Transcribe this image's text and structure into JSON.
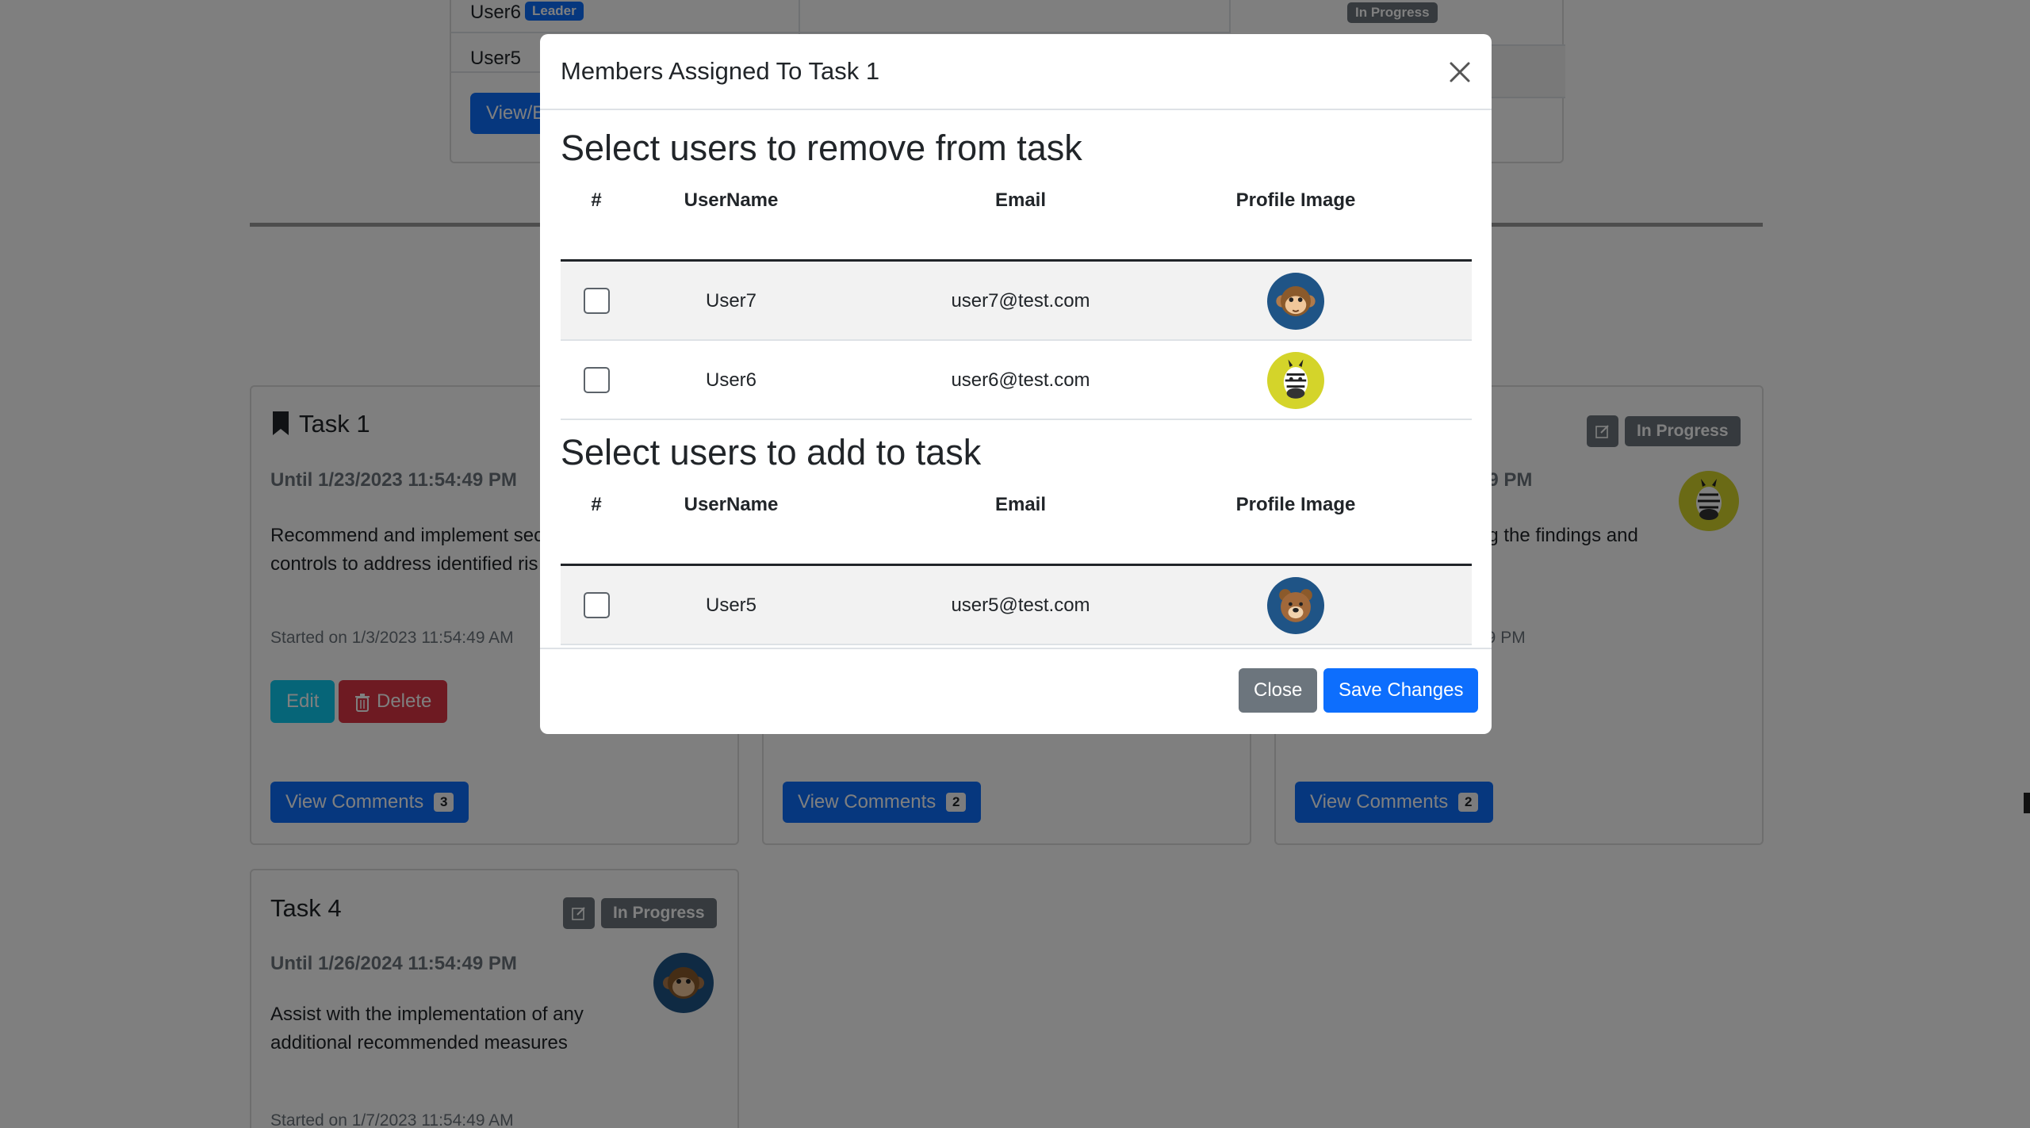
{
  "background": {
    "members": [
      {
        "name": "User6",
        "badge": "Leader"
      },
      {
        "name": "User5",
        "badge": ""
      }
    ],
    "members_button": "View/E",
    "top_status": "In Progress",
    "cards": [
      {
        "title": "Task 1",
        "until": "Until 1/23/2023 11:54:49 PM",
        "desc": "Recommend and implement sec controls to address identified ris",
        "started": "Started on 1/3/2023 11:54:49 AM",
        "edit": "Edit",
        "delete": "Delete",
        "comments": "View Comments",
        "comments_count": "3"
      },
      {
        "comments": "View Comments",
        "comments_count": "2"
      },
      {
        "until": "49 PM",
        "desc": "ng the findings and",
        "started": "49 PM",
        "status": "In Progress",
        "comments": "View Comments",
        "comments_count": "2"
      },
      {
        "title": "Task 4",
        "until": "Until 1/26/2024 11:54:49 PM",
        "desc": "Assist with the implementation of any additional recommended measures",
        "started": "Started on 1/7/2023 11:54:49 AM",
        "status": "In Progress"
      }
    ]
  },
  "modal": {
    "title": "Members Assigned To Task 1",
    "remove_section": {
      "heading": "Select users to remove from task",
      "columns": [
        "#",
        "UserName",
        "Email",
        "Profile Image"
      ],
      "rows": [
        {
          "username": "User7",
          "email": "user7@test.com",
          "avatar": "monkey-avatar"
        },
        {
          "username": "User6",
          "email": "user6@test.com",
          "avatar": "zebra-avatar"
        }
      ]
    },
    "add_section": {
      "heading": "Select users to add to task",
      "columns": [
        "#",
        "UserName",
        "Email",
        "Profile Image"
      ],
      "rows": [
        {
          "username": "User5",
          "email": "user5@test.com",
          "avatar": "bear-avatar"
        }
      ]
    },
    "footer": {
      "close_label": "Close",
      "save_label": "Save Changes"
    }
  },
  "colors": {
    "primary": "#0d6efd",
    "secondary": "#6c757d",
    "danger": "#dc3545",
    "info": "#0dcaf0",
    "avatar_blue": "#1f5486",
    "avatar_yellow": "#d4d42a"
  }
}
